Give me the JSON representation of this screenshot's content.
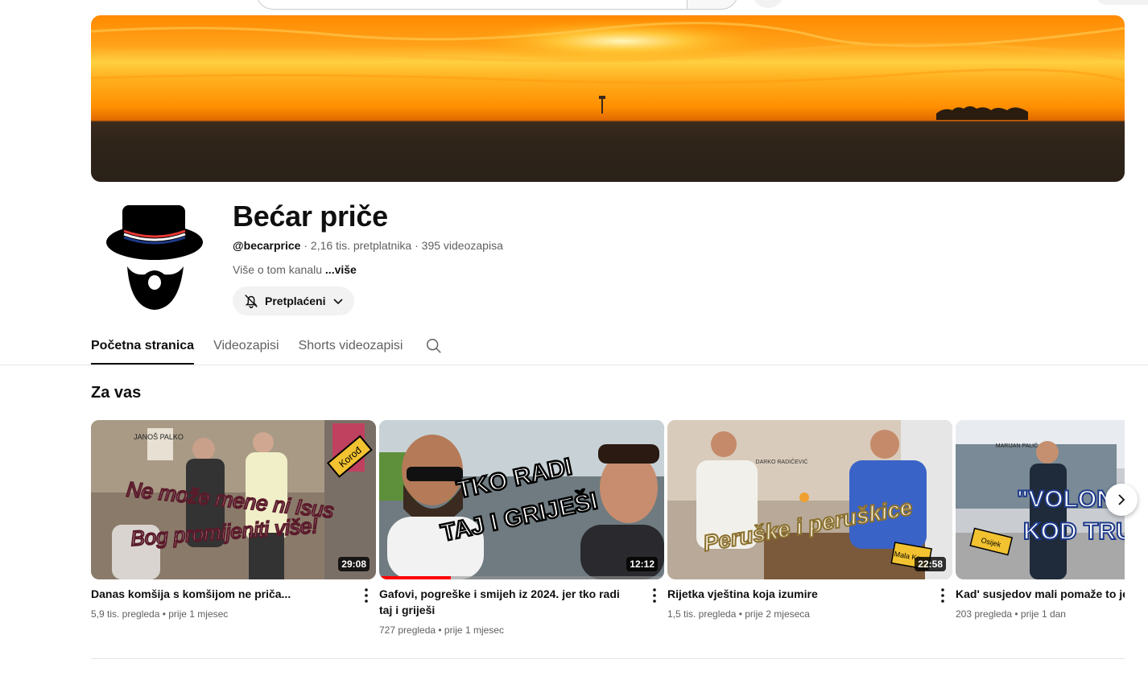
{
  "channel": {
    "name": "Bećar priče",
    "handle": "@becarprice",
    "stats": " · 2,16 tis. pretplatnika · 395 videozapisa",
    "description": "Više o tom kanalu ",
    "more_link": "...više",
    "subscribe_label": "Pretplaćeni"
  },
  "tabs": [
    {
      "label": "Početna stranica",
      "active": true
    },
    {
      "label": "Videozapisi",
      "active": false
    },
    {
      "label": "Shorts videozapisi",
      "active": false
    }
  ],
  "section": {
    "title": "Za vas"
  },
  "videos": [
    {
      "title": "Danas komšija s komšijom ne priča...",
      "meta": "5,9 tis. pregleda • prije 1 mjesec",
      "duration": "29:08",
      "overlay": [
        "Ne može mene ni Isus",
        "Bog promijeniti više!"
      ],
      "signs": [
        "JANOŠ PALKO",
        "Korođ"
      ]
    },
    {
      "title": "Gafovi, pogreške i smijeh iz 2024. jer tko radi taj i griješi",
      "meta": "727 pregleda • prije 1 mjesec",
      "duration": "12:12",
      "overlay": [
        "TKO RADI",
        "TAJ I GRIJEŠI"
      ],
      "watched_fraction": 0.25
    },
    {
      "title": "Rijetka vještina koja izumire",
      "meta": "1,5 tis. pregleda • prije 2 mjeseca",
      "duration": "22:58",
      "overlay": [
        "Peruške i peruškice"
      ],
      "signs": [
        "DARKO RADIČEVIĆ",
        "Mala Kopa"
      ]
    },
    {
      "title": "Kad' susjedov mali pomaže to je naša...",
      "meta": "203 pregleda • prije 1 dan",
      "duration": "",
      "overlay": [
        "\"VOLONTIRAM",
        "KOD TRUMPA\""
      ],
      "signs": [
        "MARIJAN PALIĆ",
        "Osijek"
      ]
    }
  ],
  "colors": {
    "accent": "#f00",
    "text": "#0f0f0f",
    "secondary": "#606060",
    "banner_sky": "#ff8a00"
  }
}
